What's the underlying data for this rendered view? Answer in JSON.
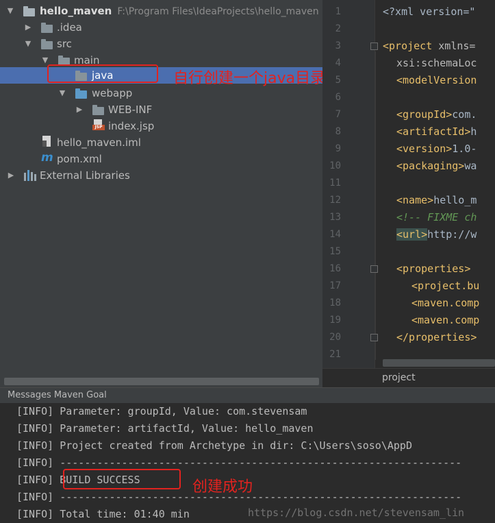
{
  "project_tree": {
    "root_label": "hello_maven",
    "root_path": "F:\\Program Files\\IdeaProjects\\hello_maven",
    "idea_folder": ".idea",
    "src_folder": "src",
    "main_folder": "main",
    "java_folder": "java",
    "webapp_folder": "webapp",
    "webinf_folder": "WEB-INF",
    "index_file": "index.jsp",
    "iml_file": "hello_maven.iml",
    "pom_file": "pom.xml",
    "external_libraries": "External Libraries",
    "jsp_tag": "JSP"
  },
  "annotations": {
    "java_note": "自行创建一个java目录",
    "build_note": "创建成功"
  },
  "editor": {
    "line_numbers": [
      "1",
      "2",
      "3",
      "4",
      "5",
      "6",
      "7",
      "8",
      "9",
      "10",
      "11",
      "12",
      "13",
      "14",
      "15",
      "16",
      "17",
      "18",
      "19",
      "20",
      "21"
    ],
    "lines": {
      "l1": "<?xml version=\"",
      "l3_tag": "<project",
      "l3_attr": " xmlns=",
      "l4_attr": "xsi:schemaLoc",
      "l5_tag": "<modelVersion",
      "l7_tag": "<groupId>",
      "l7_text": "com.",
      "l8_tag": "<artifactId>",
      "l8_text": "h",
      "l9_tag": "<version>",
      "l9_text": "1.0-",
      "l10_tag": "<packaging>",
      "l10_text": "wa",
      "l12_tag": "<name>",
      "l12_text": "hello_m",
      "l13_comment": "<!-- FIXME ch",
      "l14_tag": "<url>",
      "l14_text": "http://w",
      "l16_tag": "<properties>",
      "l17_tag": "<project.bu",
      "l18_tag": "<maven.comp",
      "l19_tag": "<maven.comp",
      "l20_tag": "</properties>"
    },
    "breadcrumb": "project"
  },
  "messages": {
    "header": "Messages Maven Goal",
    "log_lines": [
      "[INFO] Parameter: groupId, Value: com.stevensam",
      "[INFO] Parameter: artifactId, Value: hello_maven",
      "[INFO] Project created from Archetype in dir: C:\\Users\\soso\\AppD",
      "[INFO] -----------------------------------------------------------------",
      "[INFO] BUILD SUCCESS",
      "[INFO] -----------------------------------------------------------------",
      "[INFO] Total time: 01:40 min"
    ],
    "watermark": "https://blog.csdn.net/stevensam_lin"
  },
  "colors": {
    "annotation_red": "#e1231f",
    "selection_blue": "#4b6eaf"
  }
}
